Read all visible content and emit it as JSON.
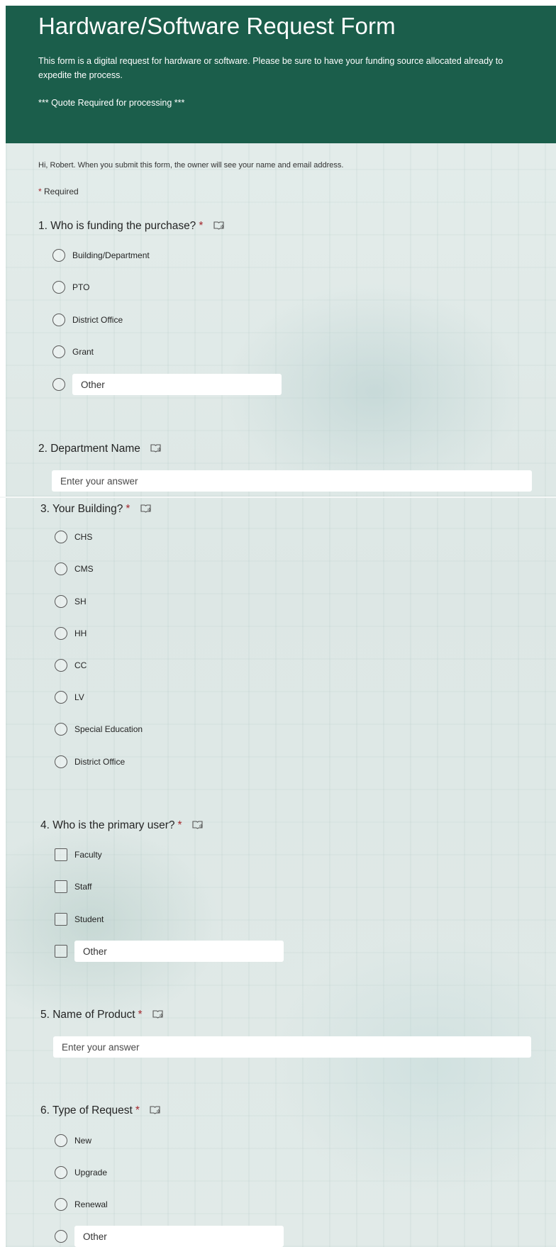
{
  "header": {
    "title": "Hardware/Software Request Form",
    "description": "This form is a digital request for hardware or software.  Please be sure to have your funding source allocated already to\nexpedite the process.",
    "quote_note": "*** Quote Required for processing ***",
    "bg_color": "#1b5e4b"
  },
  "notice": "Hi, Robert. When you submit this form, the owner will see your name and email address.",
  "required_note": {
    "star": "*",
    "text": "Required"
  },
  "questions": [
    {
      "label": "1. Who is funding the purchase?",
      "required": "*",
      "type": "radio",
      "options": [
        "Building/Department",
        "PTO",
        "District Office",
        "Grant"
      ],
      "other_label": "Other"
    },
    {
      "label": "2. Department Name",
      "type": "text",
      "placeholder": "Enter your answer"
    },
    {
      "label": "3. Your Building?",
      "required": "*",
      "type": "radio",
      "options": [
        "CHS",
        "CMS",
        "SH",
        "HH",
        "CC",
        "LV",
        "Special Education",
        "District Office"
      ]
    },
    {
      "label": "4. Who is the primary user?",
      "required": "*",
      "type": "checkbox",
      "options": [
        "Faculty",
        "Staff",
        "Student"
      ],
      "other_label": "Other"
    },
    {
      "label": "5. Name of Product",
      "required": "*",
      "type": "text",
      "placeholder": "Enter your answer"
    },
    {
      "label": "6. Type of Request",
      "required": "*",
      "type": "radio",
      "options": [
        "New",
        "Upgrade",
        "Renewal"
      ],
      "other_label": "Other"
    }
  ],
  "icons": {
    "question_reader": "immersive-reader-icon",
    "required_color": "#a4262c"
  }
}
